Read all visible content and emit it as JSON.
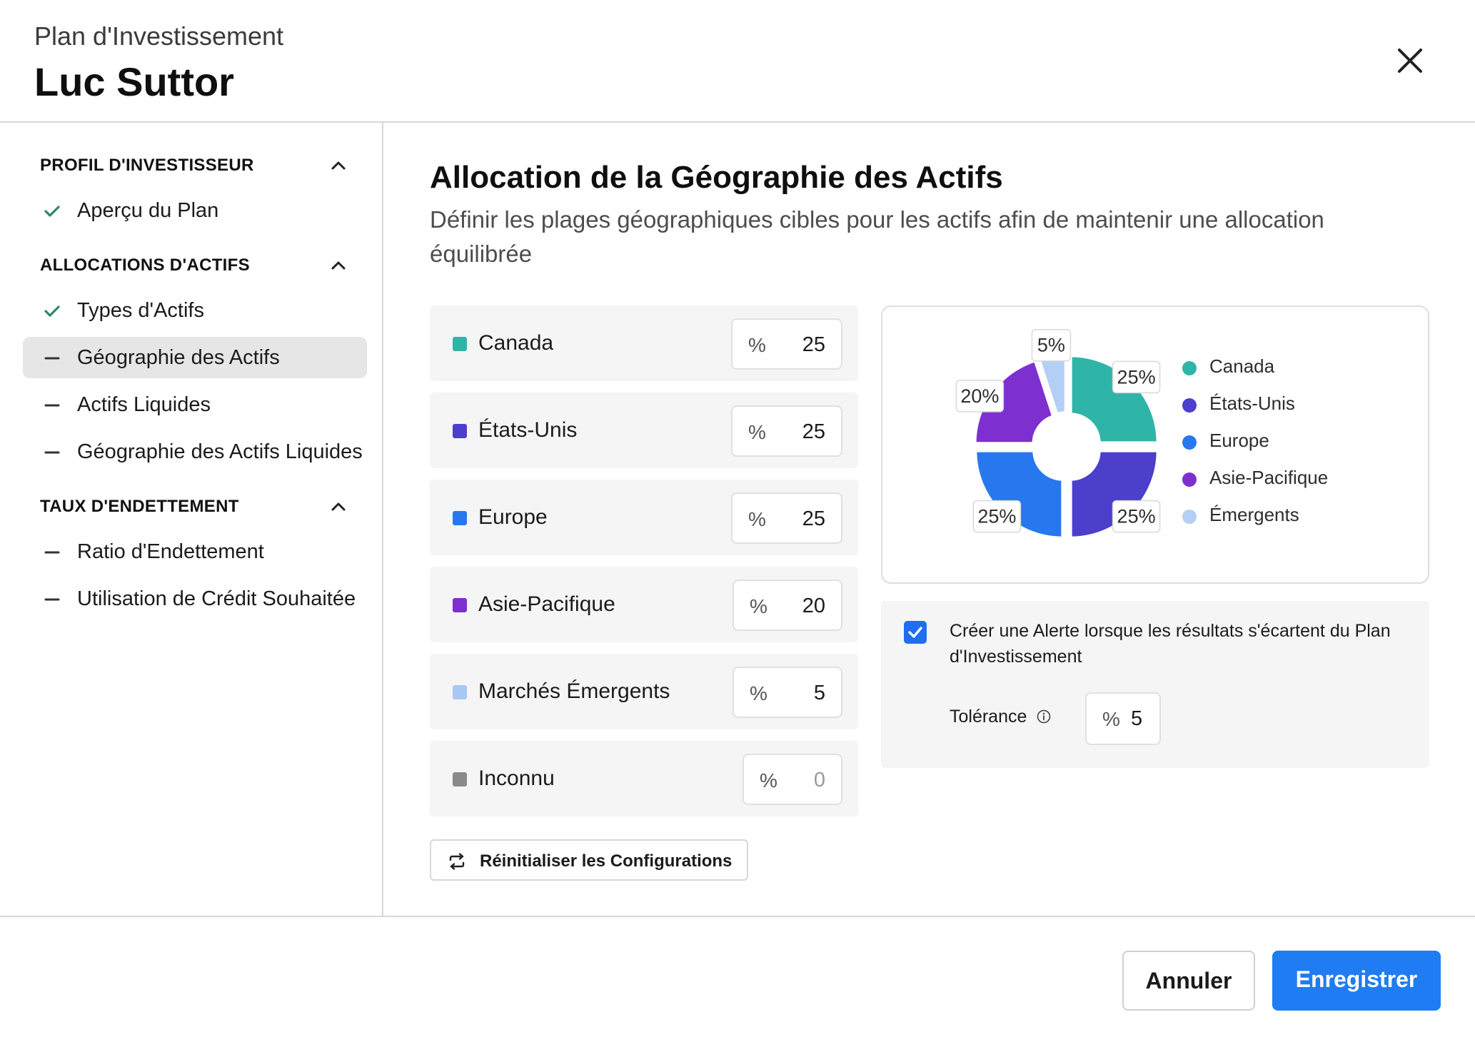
{
  "header": {
    "subtitle": "Plan d'Investissement",
    "client_name": "Luc Suttor",
    "close_icon": "close-icon"
  },
  "sidebar": {
    "sections": [
      {
        "title": "PROFIL D'INVESTISSEUR",
        "expanded": true
      },
      {
        "title": "ALLOCATIONS D'ACTIFS",
        "expanded": true
      },
      {
        "title": "TAUX D'ENDETTEMENT",
        "expanded": true
      }
    ],
    "items": [
      {
        "label": "Aperçu du Plan",
        "status": "complete",
        "icon": "check-icon"
      },
      {
        "label": "Types d'Actifs",
        "status": "complete",
        "icon": "check-icon"
      },
      {
        "label": "Géographie des Actifs",
        "status": "active",
        "icon": "dash-icon"
      },
      {
        "label": "Actifs Liquides",
        "status": "pending",
        "icon": "dash-icon"
      },
      {
        "label": "Géographie des Actifs Liquides",
        "status": "pending",
        "icon": "dash-icon"
      },
      {
        "label": "Ratio d'Endettement",
        "status": "pending",
        "icon": "dash-icon"
      },
      {
        "label": "Utilisation de Crédit Souhaitée",
        "status": "pending",
        "icon": "dash-icon"
      }
    ]
  },
  "main": {
    "title": "Allocation de la Géographie des Actifs",
    "description": "Définir les plages géographiques cibles pour les actifs afin de maintenir une allocation équilibrée",
    "rows": [
      {
        "label": "Canada",
        "unit": "%",
        "value": "25",
        "color": "#2fb5a8"
      },
      {
        "label": "États-Unis",
        "unit": "%",
        "value": "25",
        "color": "#4b3fcc"
      },
      {
        "label": "Europe",
        "unit": "%",
        "value": "25",
        "color": "#2778ee"
      },
      {
        "label": "Asie-Pacifique",
        "unit": "%",
        "value": "20",
        "color": "#7e2fd0"
      },
      {
        "label": "Marchés Émergents",
        "unit": "%",
        "value": "5",
        "color": "#a9c8f5"
      },
      {
        "label": "Inconnu",
        "unit": "%",
        "value": "0",
        "color": "#8a8a8a"
      }
    ],
    "reset_label": "Réinitialiser les Configurations"
  },
  "chart_data": {
    "type": "pie",
    "categories": [
      "Canada",
      "États-Unis",
      "Europe",
      "Asie-Pacifique",
      "Émergents"
    ],
    "values": [
      25,
      25,
      25,
      20,
      5
    ],
    "labels": [
      "25%",
      "25%",
      "25%",
      "20%",
      "5%"
    ],
    "colors": [
      "#2fb5a8",
      "#4b3fcc",
      "#2778ee",
      "#7e2fd0",
      "#b4cff6"
    ],
    "legend_position": "right",
    "donut": true
  },
  "alert": {
    "checked": true,
    "text": "Créer une Alerte lorsque les résultats s'écartent du Plan d'Investissement",
    "tolerance_label": "Tolérance",
    "tolerance_unit": "%",
    "tolerance_value": "5"
  },
  "footer": {
    "cancel_label": "Annuler",
    "save_label": "Enregistrer"
  }
}
